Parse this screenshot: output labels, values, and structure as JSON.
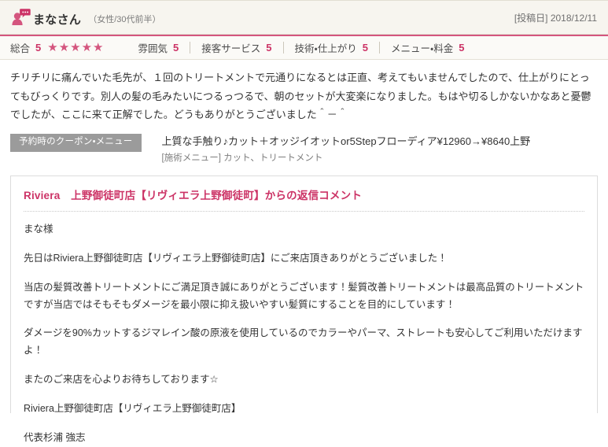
{
  "header": {
    "user_name": "まなさん",
    "user_meta": "（女性/30代前半）",
    "post_date": "[投稿日] 2018/12/11",
    "avatar_icon": "user-speech-bubble-icon"
  },
  "ratings": {
    "total_label": "総合",
    "total_score": "5",
    "stars": "★★★★★",
    "items": [
      {
        "label": "雰囲気",
        "score": "5"
      },
      {
        "label": "接客サービス",
        "score": "5"
      },
      {
        "label": "技術・仕上がり",
        "score": "5"
      },
      {
        "label": "メニュー・料金",
        "score": "5"
      }
    ]
  },
  "review": {
    "text": "チリチリに痛んでいた毛先が、１回のトリートメントで元通りになるとは正直、考えてもいませんでしたので、仕上がりにとってもびっくりです。別人の髪の毛みたいにつるっつるで、朝のセットが大変楽になりました。もはや切るしかないかなあと憂鬱でしたが、ここに来て正解でした。どうもありがとうございました＾－＾"
  },
  "coupon": {
    "badge": "予約時のクーポン・メニュー",
    "title": "上質な手触り♪カット＋オッジイオットor5Stepフローディア¥12960→¥8640上野",
    "sub": "[施術メニュー] カット、トリートメント"
  },
  "reply": {
    "heading": "Riviera　上野御徒町店【リヴィエラ上野御徒町】からの返信コメント",
    "paragraphs": [
      "まな様",
      "先日はRiviera上野御徒町店【リヴィエラ上野御徒町店】にご来店頂きありがとうございました！",
      "当店の髪質改善トリートメントにご満足頂き誠にありがとうございます！髪質改善トリートメントは最高品質のトリートメントですが当店ではそもそもダメージを最小限に抑え扱いやすい髪質にすることを目的にしています！",
      "ダメージを90%カットするジマレイン酸の原液を使用しているのでカラーやパーマ、ストレートも安心してご利用いただけますよ！",
      "またのご来店を心よりお待ちしております☆",
      "Riviera上野御徒町店【リヴィエラ上野御徒町店】",
      "代表杉浦 強志"
    ]
  },
  "colors": {
    "accent_pink": "#cc3366",
    "star_pink": "#d4557e",
    "header_bg": "#f7f5ef",
    "badge_gray": "#9b9b9b"
  }
}
